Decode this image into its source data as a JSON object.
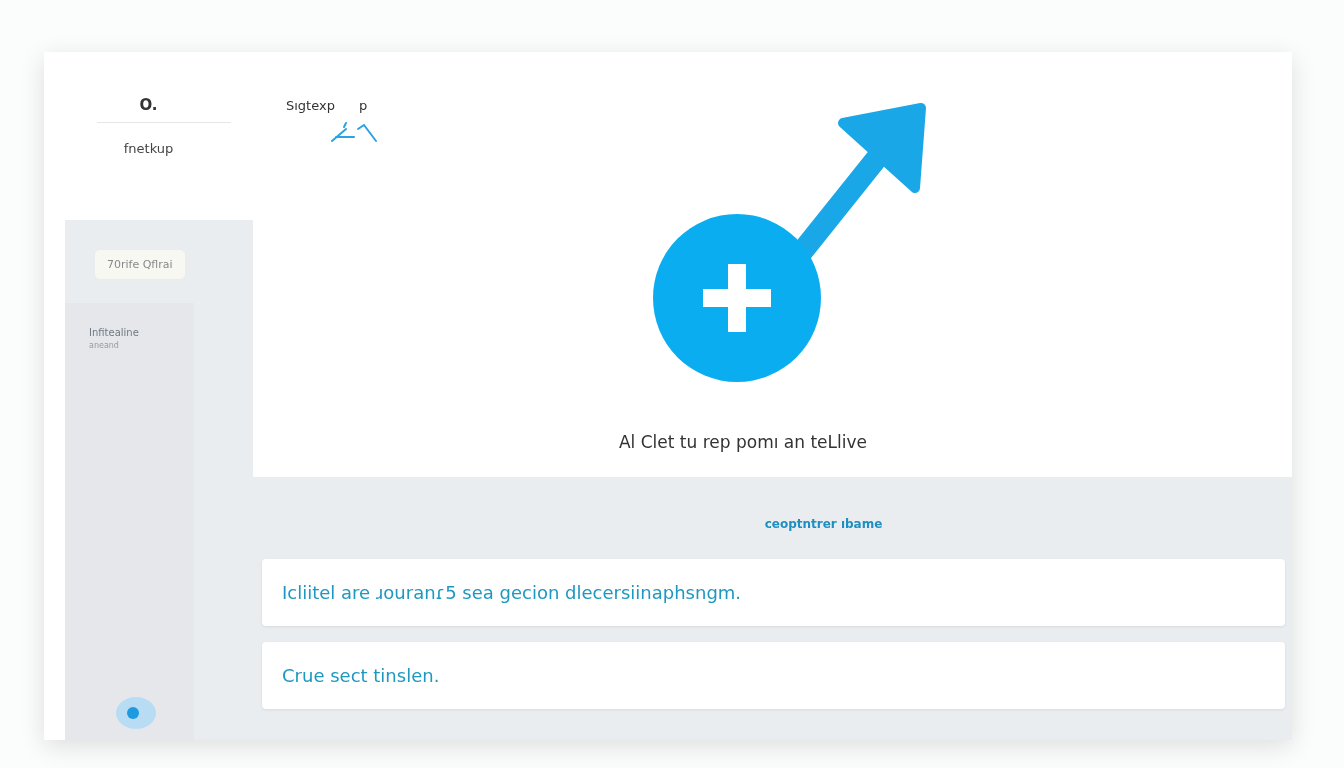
{
  "sidebar": {
    "brand": "O.",
    "subtitle": "fnetkup",
    "chip": "70rife Qflrai",
    "items": [
      {
        "title": "Infitealine",
        "meta": "aneand"
      }
    ]
  },
  "header": {
    "title": "Sıgtexp",
    "suffix": "p"
  },
  "hero": {
    "caption": "Al Clet tu rep pomı an teLlive"
  },
  "section": {
    "label": "ceoptntrer ıbame",
    "cards": [
      {
        "text": "Icliitel are ɹouranɾ5 sea gecion dlecersiinaphsngm."
      },
      {
        "text": "Crue sect tinslen."
      }
    ]
  }
}
